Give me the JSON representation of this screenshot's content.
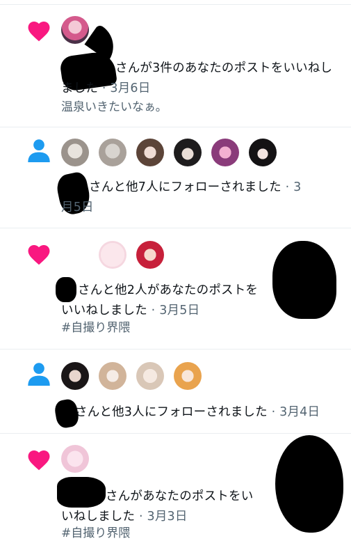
{
  "colors": {
    "like": "#f91880",
    "follow": "#1d9bf0",
    "muted": "#536471",
    "divider": "#eaeef1"
  },
  "notifications": [
    {
      "type": "like",
      "icon": "heart-icon",
      "text_visible": "さんが3件のあなたのポストをいいねしました",
      "date": "· 3月6日",
      "sub": "温泉いきたいなぁ。"
    },
    {
      "type": "follow",
      "icon": "person-icon",
      "text_visible": "さんと他7人にフォローされました",
      "date": "· 3月5日"
    },
    {
      "type": "like",
      "icon": "heart-icon",
      "text_visible": "さんと他2人があなたのポストをいいねしました",
      "date": "· 3月5日",
      "sub": "#自撮り界隈"
    },
    {
      "type": "follow",
      "icon": "person-icon",
      "text_visible": "さんと他3人にフォローされました",
      "date": "· 3月4日"
    },
    {
      "type": "like",
      "icon": "heart-icon",
      "text_visible": "さんがあなたのポストをいいねしました",
      "date": "· 3月3日",
      "sub": "#自撮り界隈"
    }
  ]
}
